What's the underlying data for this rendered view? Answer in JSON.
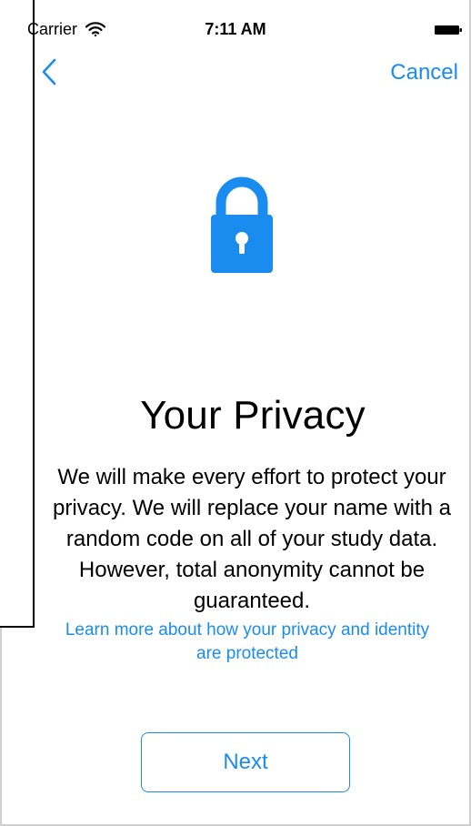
{
  "status_bar": {
    "carrier": "Carrier",
    "time": "7:11 AM",
    "wifi_icon": "wifi-icon",
    "battery_icon": "battery-icon"
  },
  "nav": {
    "back_icon": "chevron-left-icon",
    "cancel_label": "Cancel"
  },
  "content": {
    "hero_icon": "lock-icon",
    "title": "Your Privacy",
    "body": "We will make every effort to protect your privacy. We will replace your name with a random code on all of your study data. However, total anonymity cannot be guaranteed.",
    "learn_more": "Learn more about how your privacy and identity are protected"
  },
  "footer": {
    "next_label": "Next"
  },
  "colors": {
    "accent": "#1a8cf0",
    "text": "#000000",
    "background": "#ffffff"
  }
}
